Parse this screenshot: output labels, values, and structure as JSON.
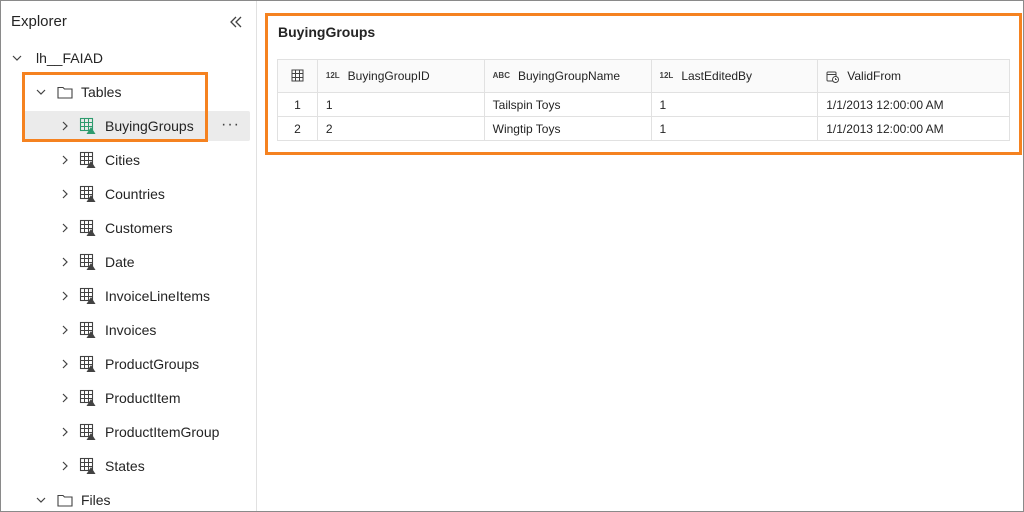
{
  "explorer": {
    "title": "Explorer",
    "lakehouse": "lh__FAIAD",
    "tables_folder": "Tables",
    "tables": [
      {
        "label": "BuyingGroups",
        "selected": true
      },
      {
        "label": "Cities"
      },
      {
        "label": "Countries"
      },
      {
        "label": "Customers"
      },
      {
        "label": "Date"
      },
      {
        "label": "InvoiceLineItems"
      },
      {
        "label": "Invoices"
      },
      {
        "label": "ProductGroups"
      },
      {
        "label": "ProductItem"
      },
      {
        "label": "ProductItemGroup"
      },
      {
        "label": "States"
      }
    ],
    "files_folder": "Files",
    "more_label": "···"
  },
  "preview": {
    "title": "BuyingGroups",
    "columns": [
      {
        "name": "BuyingGroupID",
        "type_tag": "12L"
      },
      {
        "name": "BuyingGroupName",
        "type_tag": "ABC"
      },
      {
        "name": "LastEditedBy",
        "type_tag": "12L"
      },
      {
        "name": "ValidFrom",
        "type_icon": "datetime-icon"
      }
    ],
    "rows": [
      {
        "num": "1",
        "cells": [
          "1",
          "Tailspin Toys",
          "1",
          "1/1/2013 12:00:00 AM"
        ]
      },
      {
        "num": "2",
        "cells": [
          "2",
          "Wingtip Toys",
          "1",
          "1/1/2013 12:00:00 AM"
        ]
      }
    ]
  },
  "colors": {
    "highlight": "#f58220",
    "selected_row": "#ebebeb",
    "table_icon_accent": "#2e9b6e"
  }
}
